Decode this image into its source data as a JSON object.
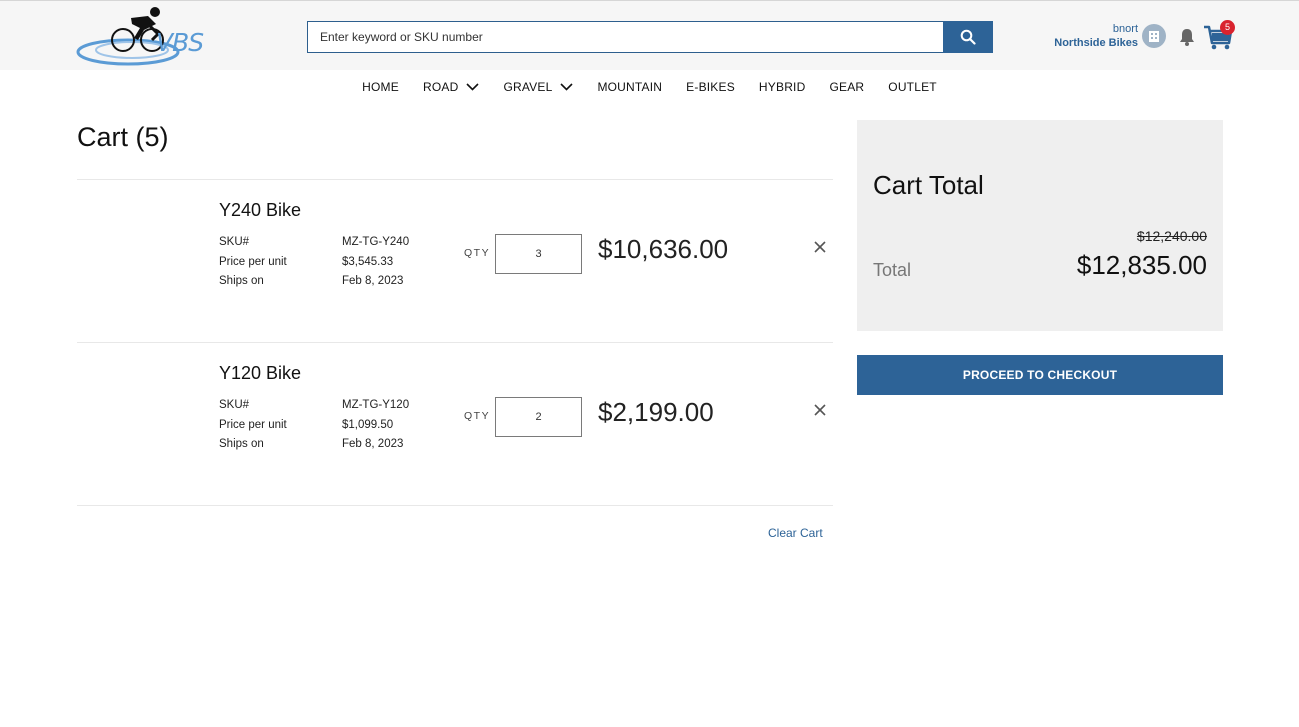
{
  "header": {
    "logo_text": "VBS",
    "search_placeholder": "Enter keyword or SKU number",
    "user_name": "bnort",
    "company": "Northside Bikes",
    "cart_count": "5"
  },
  "nav": {
    "items": [
      {
        "label": "HOME",
        "dropdown": false
      },
      {
        "label": "ROAD",
        "dropdown": true
      },
      {
        "label": "GRAVEL",
        "dropdown": true
      },
      {
        "label": "MOUNTAIN",
        "dropdown": false
      },
      {
        "label": "E-BIKES",
        "dropdown": false
      },
      {
        "label": "HYBRID",
        "dropdown": false
      },
      {
        "label": "GEAR",
        "dropdown": false
      },
      {
        "label": "OUTLET",
        "dropdown": false
      }
    ]
  },
  "cart": {
    "title": "Cart (5)",
    "spec_labels": {
      "sku": "SKU#",
      "price": "Price per unit",
      "ships": "Ships on"
    },
    "qty_label": "QTY",
    "items": [
      {
        "name": "Y240 Bike",
        "sku": "MZ-TG-Y240",
        "price_per_unit": "$3,545.33",
        "ships_on": "Feb 8, 2023",
        "qty": "3",
        "line_total": "$10,636.00"
      },
      {
        "name": "Y120 Bike",
        "sku": "MZ-TG-Y120",
        "price_per_unit": "$1,099.50",
        "ships_on": "Feb 8, 2023",
        "qty": "2",
        "line_total": "$2,199.00"
      }
    ],
    "clear_label": "Clear Cart"
  },
  "summary": {
    "title": "Cart Total",
    "original_total": "$12,240.00",
    "total_label": "Total",
    "total_value": "$12,835.00",
    "checkout_label": "PROCEED TO CHECKOUT"
  },
  "colors": {
    "brand_blue": "#2d6397",
    "badge_red": "#d9232e",
    "summary_bg": "#efefef"
  }
}
